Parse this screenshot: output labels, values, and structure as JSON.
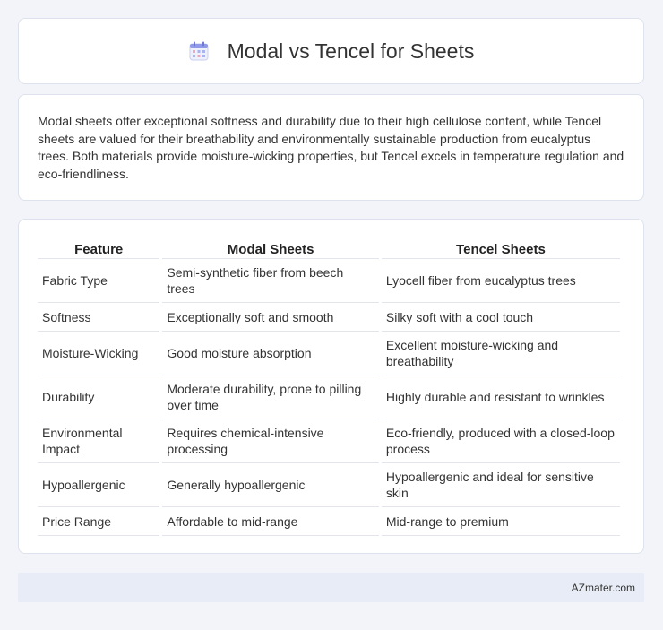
{
  "header": {
    "title": "Modal vs Tencel for Sheets",
    "icon": "calendar-icon"
  },
  "summary": {
    "text": "Modal sheets offer exceptional softness and durability due to their high cellulose content, while Tencel sheets are valued for their breathability and environmentally sustainable production from eucalyptus trees. Both materials provide moisture-wicking properties, but Tencel excels in temperature regulation and eco-friendliness."
  },
  "table": {
    "headers": [
      "Feature",
      "Modal Sheets",
      "Tencel Sheets"
    ],
    "rows": [
      [
        "Fabric Type",
        "Semi-synthetic fiber from beech trees",
        "Lyocell fiber from eucalyptus trees"
      ],
      [
        "Softness",
        "Exceptionally soft and smooth",
        "Silky soft with a cool touch"
      ],
      [
        "Moisture-Wicking",
        "Good moisture absorption",
        "Excellent moisture-wicking and breathability"
      ],
      [
        "Durability",
        "Moderate durability, prone to pilling over time",
        "Highly durable and resistant to wrinkles"
      ],
      [
        "Environmental Impact",
        "Requires chemical-intensive processing",
        "Eco-friendly, produced with a closed-loop process"
      ],
      [
        "Hypoallergenic",
        "Generally hypoallergenic",
        "Hypoallergenic and ideal for sensitive skin"
      ],
      [
        "Price Range",
        "Affordable to mid-range",
        "Mid-range to premium"
      ]
    ]
  },
  "footer": {
    "brand": "AZmater.com"
  }
}
